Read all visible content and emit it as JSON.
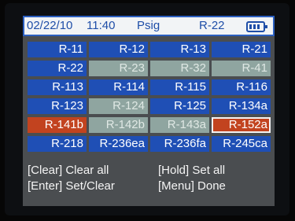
{
  "status_bar": {
    "date": "02/22/10",
    "time": "11:40",
    "unit": "Psig",
    "refrigerant": "R-22",
    "icon": "battery-icon"
  },
  "refrigerants": [
    {
      "label": "R-11",
      "state": "selected"
    },
    {
      "label": "R-12",
      "state": "selected"
    },
    {
      "label": "R-13",
      "state": "selected"
    },
    {
      "label": "R-21",
      "state": "selected"
    },
    {
      "label": "R-22",
      "state": "selected"
    },
    {
      "label": "R-23",
      "state": "unselected"
    },
    {
      "label": "R-32",
      "state": "unselected"
    },
    {
      "label": "R-41",
      "state": "unselected"
    },
    {
      "label": "R-113",
      "state": "selected"
    },
    {
      "label": "R-114",
      "state": "selected"
    },
    {
      "label": "R-115",
      "state": "selected"
    },
    {
      "label": "R-116",
      "state": "selected"
    },
    {
      "label": "R-123",
      "state": "selected"
    },
    {
      "label": "R-124",
      "state": "unselected"
    },
    {
      "label": "R-125",
      "state": "selected"
    },
    {
      "label": "R-134a",
      "state": "selected"
    },
    {
      "label": "R-141b",
      "state": "highlighted"
    },
    {
      "label": "R-142b",
      "state": "unselected"
    },
    {
      "label": "R-143a",
      "state": "unselected"
    },
    {
      "label": "R-152a",
      "state": "highlighted-cursor"
    },
    {
      "label": "R-218",
      "state": "selected"
    },
    {
      "label": "R-236ea",
      "state": "selected"
    },
    {
      "label": "R-236fa",
      "state": "selected"
    },
    {
      "label": "R-245ca",
      "state": "selected"
    }
  ],
  "help": {
    "clear": "[Clear] Clear all",
    "hold": "[Hold] Set all",
    "enter": "[Enter] Set/Clear",
    "menu": "[Menu] Done"
  },
  "colors": {
    "selected": "#1f4fb5",
    "unselected": "#8fa5a0",
    "highlighted": "#c2431f",
    "screen_bg": "#4a4d50",
    "status_text": "#1f4ea8"
  }
}
